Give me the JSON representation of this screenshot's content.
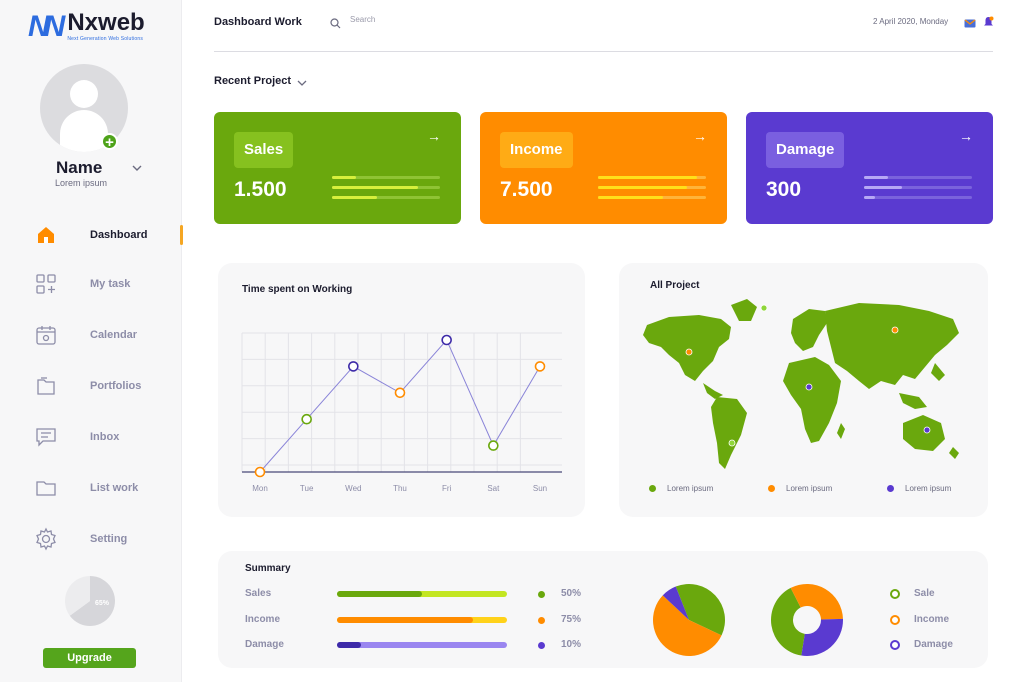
{
  "brand": {
    "name": "Nxweb",
    "tagline": "Next Generation Web Solutions"
  },
  "profile": {
    "name": "Name",
    "subtitle": "Lorem ipsum"
  },
  "nav": [
    {
      "label": "Dashboard",
      "icon": "home-icon",
      "active": true
    },
    {
      "label": "My task",
      "icon": "grid-plus-icon"
    },
    {
      "label": "Calendar",
      "icon": "calendar-icon"
    },
    {
      "label": "Portfolios",
      "icon": "folder-files-icon"
    },
    {
      "label": "Inbox",
      "icon": "inbox-icon"
    },
    {
      "label": "List work",
      "icon": "folder-icon"
    },
    {
      "label": "Setting",
      "icon": "gear-icon"
    }
  ],
  "usage": {
    "percent": 65,
    "label": "65%"
  },
  "upgrade_label": "Upgrade",
  "topbar": {
    "title": "Dashboard Work",
    "search_placeholder": "Search",
    "date": "2 April 2020, Monday"
  },
  "recent_label": "Recent Project",
  "cards": [
    {
      "label": "Sales",
      "value": "1.500",
      "bg": "#6aa80d",
      "label_bg": "#86c11f",
      "bars": [
        0.22,
        0.8,
        0.42
      ],
      "track": "#8fc434",
      "fill": "#d7f03c"
    },
    {
      "label": "Income",
      "value": "7.500",
      "bg": "#ff8c00",
      "label_bg": "#ffab15",
      "bars": [
        0.92,
        0.82,
        0.6
      ],
      "track": "#ffb43a",
      "fill": "#ffe01a"
    },
    {
      "label": "Damage",
      "value": "300",
      "bg": "#5a3ad0",
      "label_bg": "#7a5fe0",
      "bars": [
        0.22,
        0.35,
        0.1
      ],
      "track": "#7a62dc",
      "fill": "#b7a8f5"
    }
  ],
  "line_chart": {
    "title": "Time spent on Working",
    "days": [
      "Mon",
      "Tue",
      "Wed",
      "Thu",
      "Fri",
      "Sat",
      "Sun"
    ],
    "values": [
      0,
      2,
      4,
      3,
      5,
      1,
      4
    ],
    "colors": [
      "#ff8c00",
      "#6aa80d",
      "#3d2aa8",
      "#ff8c00",
      "#3d2aa8",
      "#6aa80d",
      "#ff8c00"
    ]
  },
  "map": {
    "title": "All Project",
    "legend": [
      {
        "label": "Lorem ipsum",
        "color": "#6aa80d"
      },
      {
        "label": "Lorem ipsum",
        "color": "#ff8c00"
      },
      {
        "label": "Lorem ipsum",
        "color": "#5a3ad0"
      }
    ]
  },
  "summary": {
    "title": "Summary",
    "rows": [
      {
        "label": "Sales",
        "percent": "50%",
        "value": 0.5,
        "fill": "#6aa80d",
        "track": "#c3e622",
        "dot": "#6aa80d"
      },
      {
        "label": "Income",
        "percent": "75%",
        "value": 0.8,
        "fill": "#ff8c00",
        "track": "#ffd21a",
        "dot": "#ff8c00"
      },
      {
        "label": "Damage",
        "percent": "10%",
        "value": 0.14,
        "fill": "#3d2aa8",
        "track": "#9a86f0",
        "dot": "#5a3ad0"
      }
    ],
    "pie": [
      {
        "label": "Sale",
        "value": 0.38,
        "color": "#6aa80d"
      },
      {
        "label": "Income",
        "value": 0.55,
        "color": "#ff8c00"
      },
      {
        "label": "Damage",
        "value": 0.07,
        "color": "#5a3ad0"
      }
    ],
    "donut": [
      {
        "label": "Sale",
        "value": 0.4,
        "color": "#6aa80d"
      },
      {
        "label": "Income",
        "value": 0.32,
        "color": "#ff8c00"
      },
      {
        "label": "Damage",
        "value": 0.28,
        "color": "#5a3ad0"
      }
    ],
    "legend": [
      {
        "label": "Sale",
        "color": "#6aa80d"
      },
      {
        "label": "Income",
        "color": "#ff8c00"
      },
      {
        "label": "Damage",
        "color": "#5a3ad0"
      }
    ]
  }
}
